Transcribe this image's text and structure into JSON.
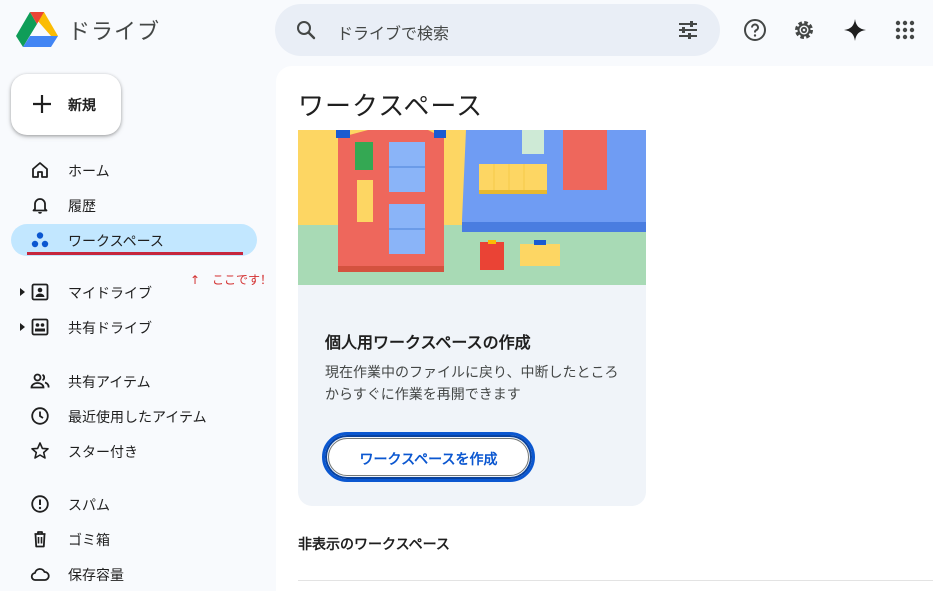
{
  "header": {
    "app_title": "ドライブ",
    "search_placeholder": "ドライブで検索",
    "icons": [
      "drive-logo",
      "search-icon",
      "tune-icon",
      "help-icon",
      "settings-icon",
      "gemini-icon",
      "apps-grid-icon"
    ]
  },
  "sidebar": {
    "new_label": "新規",
    "items": [
      {
        "label": "ホーム",
        "icon": "home-icon"
      },
      {
        "label": "履歴",
        "icon": "bell-icon"
      },
      {
        "label": "ワークスペース",
        "icon": "workspace-icon",
        "active": true
      },
      {
        "label": "マイドライブ",
        "icon": "my-drive-icon"
      },
      {
        "label": "共有ドライブ",
        "icon": "shared-drive-icon"
      },
      {
        "label": "共有アイテム",
        "icon": "people-icon"
      },
      {
        "label": "最近使用したアイテム",
        "icon": "clock-icon"
      },
      {
        "label": "スター付き",
        "icon": "star-icon"
      },
      {
        "label": "スパム",
        "icon": "spam-icon"
      },
      {
        "label": "ゴミ箱",
        "icon": "trash-icon"
      },
      {
        "label": "保存容量",
        "icon": "cloud-icon"
      }
    ],
    "annotation": "↑　ここです！"
  },
  "main": {
    "title": "ワークスペース",
    "card": {
      "title": "個人用ワークスペースの作成",
      "description": "現在作業中のファイルに戻り、中断したところからすぐに作業を再開できます",
      "button_label": "ワークスペースを作成"
    },
    "hidden_section_title": "非表示のワークスペース"
  },
  "colors": {
    "accent": "#0b57d0",
    "active_nav": "#c2e7ff",
    "annotation": "#c6263d"
  }
}
